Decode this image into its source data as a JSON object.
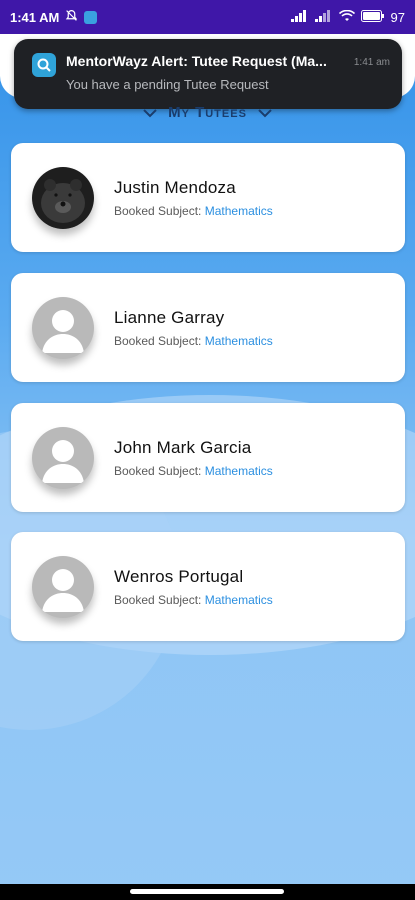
{
  "status_bar": {
    "time": "1:41 AM",
    "battery": "97"
  },
  "notification": {
    "title": "MentorWayz Alert: Tutee Request (Ma...",
    "text": "You have a pending Tutee Request",
    "time": "1:41 am"
  },
  "section_dropdown": {
    "label": "My Tutees"
  },
  "tutees": [
    {
      "name": "Justin Mendoza",
      "subject_label": "Booked Subject:",
      "subject": "Mathematics",
      "avatar": "bear-photo"
    },
    {
      "name": "Lianne Garray",
      "subject_label": "Booked Subject:",
      "subject": "Mathematics",
      "avatar": "default-user-icon"
    },
    {
      "name": "John Mark Garcia",
      "subject_label": "Booked Subject:",
      "subject": "Mathematics",
      "avatar": "default-user-icon"
    },
    {
      "name": "Wenros Portugal",
      "subject_label": "Booked Subject:",
      "subject": "Mathematics",
      "avatar": "default-user-icon"
    }
  ],
  "colors": {
    "status_bar": "#3f17a8",
    "accent": "#2b8fe0",
    "notification_bg": "#1f2125"
  }
}
